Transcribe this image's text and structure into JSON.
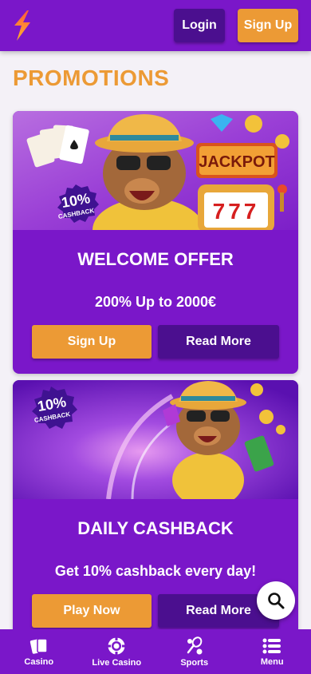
{
  "header": {
    "logo_icon": "lightning-logo-icon",
    "login_label": "Login",
    "signup_label": "Sign Up"
  },
  "page": {
    "title": "PROMOTIONS"
  },
  "promotions": [
    {
      "badge_percent": "10%",
      "badge_text": "CASHBACK",
      "banner_sign": "JACKPOT",
      "slot_numbers": "777",
      "title": "WELCOME OFFER",
      "subtitle": "200% Up to 2000€",
      "primary_label": "Sign Up",
      "secondary_label": "Read More"
    },
    {
      "badge_percent": "10%",
      "badge_text": "CASHBACK",
      "title": "DAILY CASHBACK",
      "subtitle": "Get 10% cashback every day!",
      "primary_label": "Play Now",
      "secondary_label": "Read More"
    }
  ],
  "search_fab": {
    "icon": "search-icon"
  },
  "bottom_nav": [
    {
      "label": "Casino",
      "icon": "cards-icon"
    },
    {
      "label": "Live Casino",
      "icon": "poker-chip-icon"
    },
    {
      "label": "Sports",
      "icon": "sports-icon"
    },
    {
      "label": "Menu",
      "icon": "menu-list-icon"
    }
  ],
  "colors": {
    "brand_purple": "#7a17c9",
    "dark_purple": "#4b0f8f",
    "accent_orange": "#ec9a35",
    "page_bg": "#f4f1f7"
  }
}
